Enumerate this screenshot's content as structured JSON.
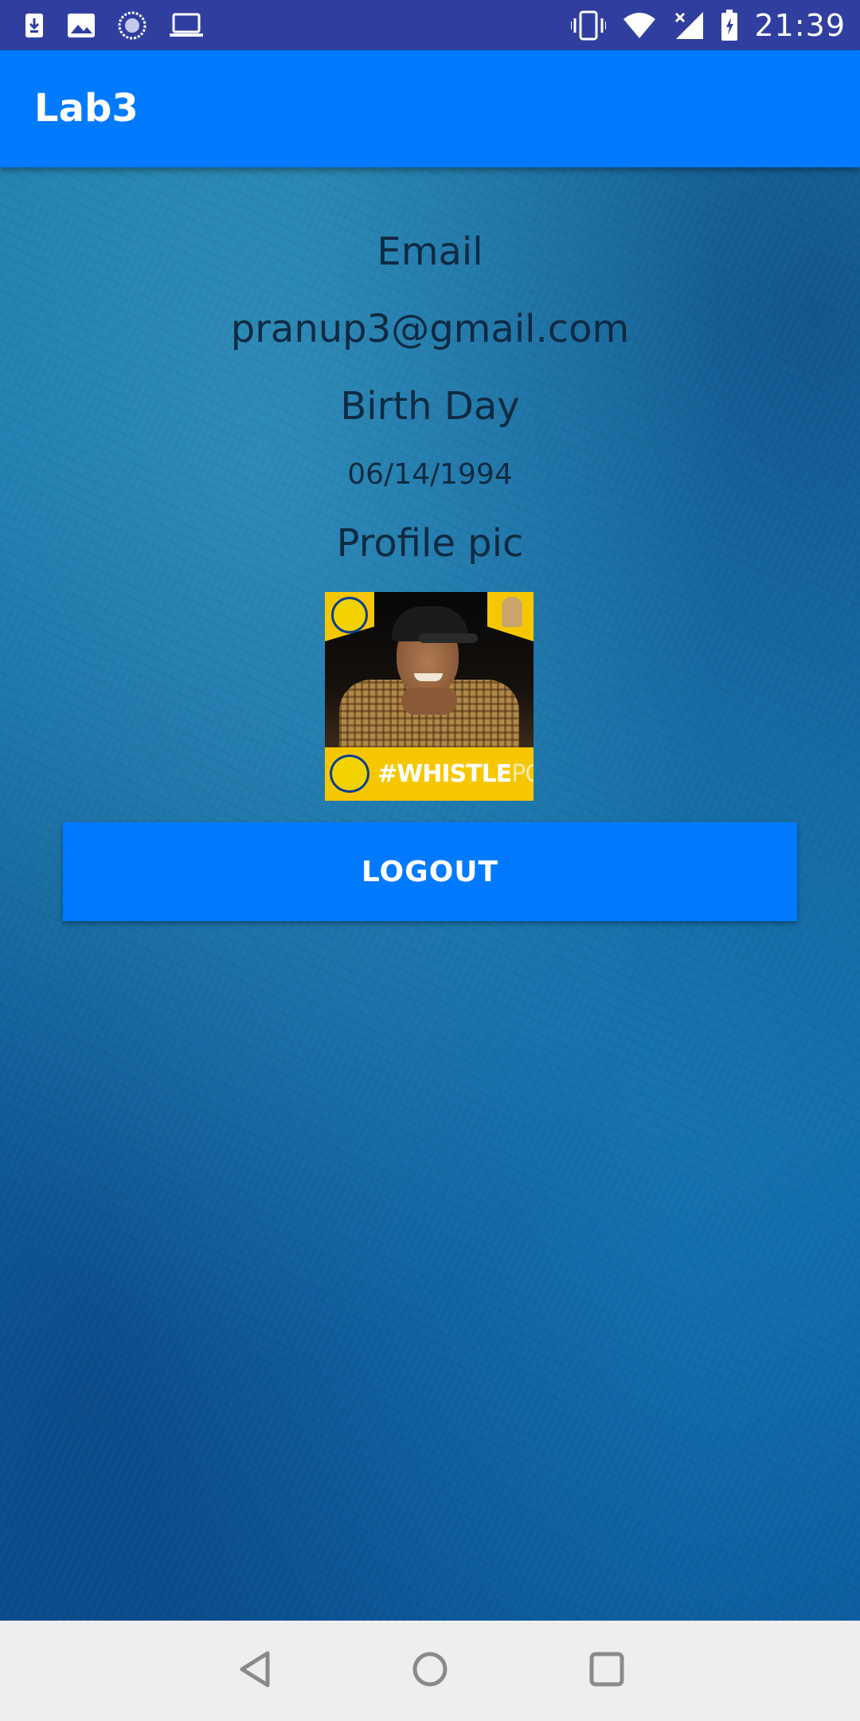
{
  "status_bar": {
    "time": "21:39",
    "left_icons": [
      "download-icon",
      "image-icon",
      "sync-icon",
      "laptop-icon"
    ],
    "right_icons": [
      "vibrate-icon",
      "wifi-icon",
      "signal-icon",
      "battery-charging-icon"
    ]
  },
  "app_bar": {
    "title": "Lab3",
    "color": "#007aff"
  },
  "profile": {
    "email_label": "Email",
    "email_value": "pranup3@gmail.com",
    "birthday_label": "Birth Day",
    "birthday_value": "06/14/1994",
    "picture_label": "Profile pic",
    "picture_hashtag_bold": "#WHISTLE",
    "picture_hashtag_light": "PODU"
  },
  "actions": {
    "logout_label": "LOGOUT"
  },
  "nav_bar": {
    "buttons": [
      "back-icon",
      "home-icon",
      "recents-icon"
    ]
  },
  "colors": {
    "status_bar": "#303f9f",
    "accent": "#007aff",
    "text": "#0f2a43",
    "nav_bar": "#eeeeee"
  }
}
